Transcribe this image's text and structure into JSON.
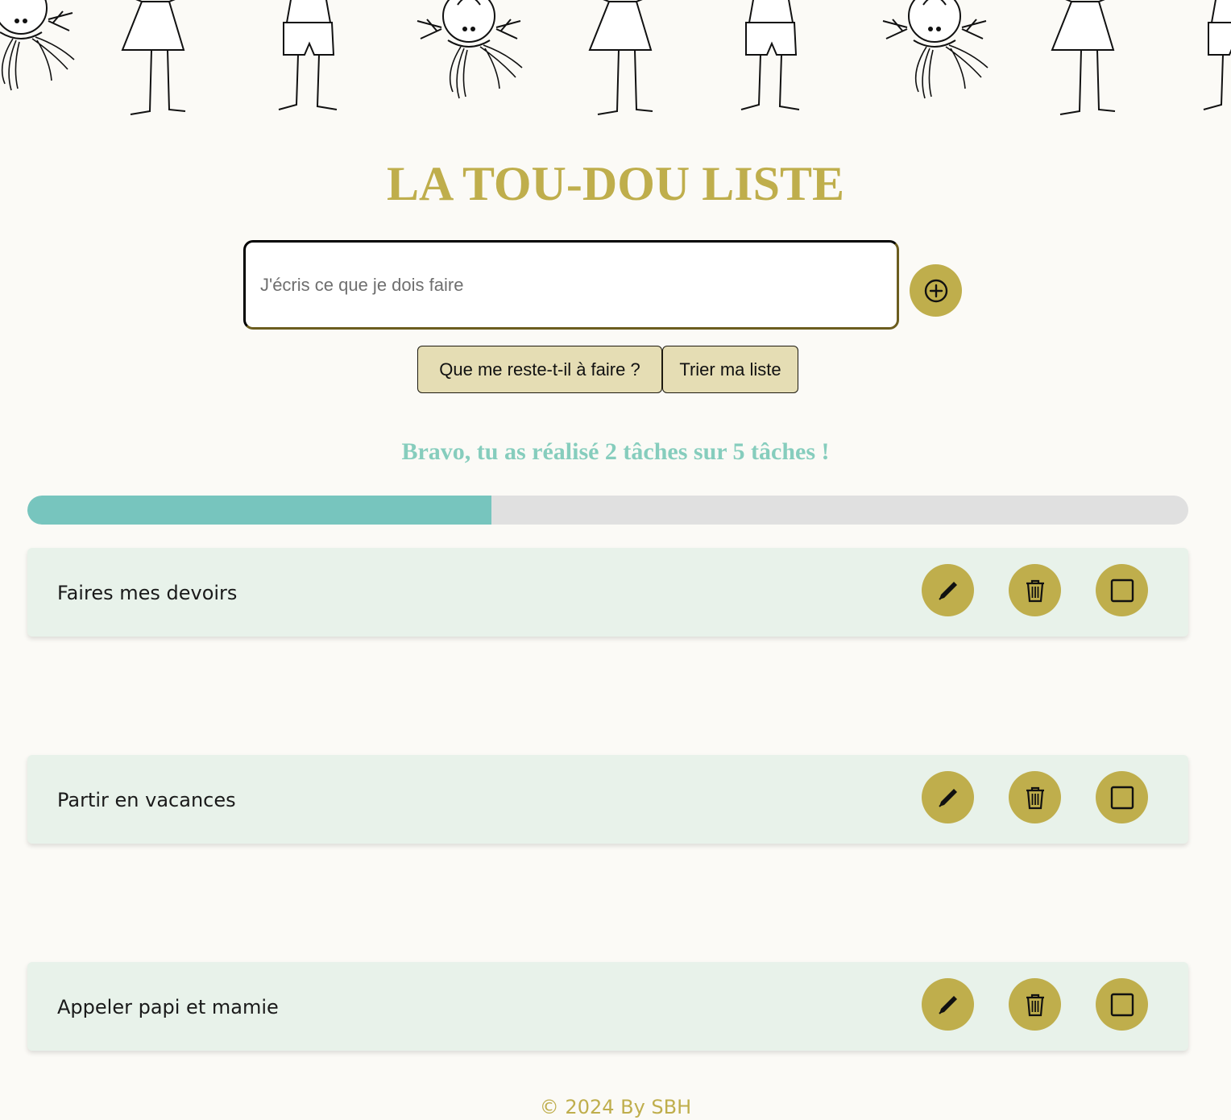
{
  "header": {
    "title": "LA TOU-DOU LISTE"
  },
  "form": {
    "input_placeholder": "J'écris ce que je dois faire",
    "input_value": "",
    "add_icon": "plus-circle-icon"
  },
  "actions": {
    "remaining_label": "Que me reste-t-il à faire ?",
    "sort_label": "Trier ma liste"
  },
  "progress": {
    "message": "Bravo, tu as réalisé 2 tâches sur 5 tâches !",
    "done": 2,
    "total": 5,
    "fraction": 0.4
  },
  "tasks": [
    {
      "label": "Faires mes devoirs",
      "done": false
    },
    {
      "label": "Partir en vacances",
      "done": false
    },
    {
      "label": "Appeler papi et mamie",
      "done": false
    }
  ],
  "task_icons": {
    "edit": "pencil-icon",
    "delete": "trash-icon",
    "complete": "checkbox-icon"
  },
  "footer": {
    "text": "© 2024 By SBH"
  },
  "colors": {
    "accent": "#bfae4c",
    "progress_fill": "#77c5be",
    "progress_track": "#e0e0e0",
    "progress_text": "#86cdbd",
    "card_background": "#e8f2ea",
    "page_background": "#fbfaf6",
    "pill_button": "#e5ddb4"
  }
}
